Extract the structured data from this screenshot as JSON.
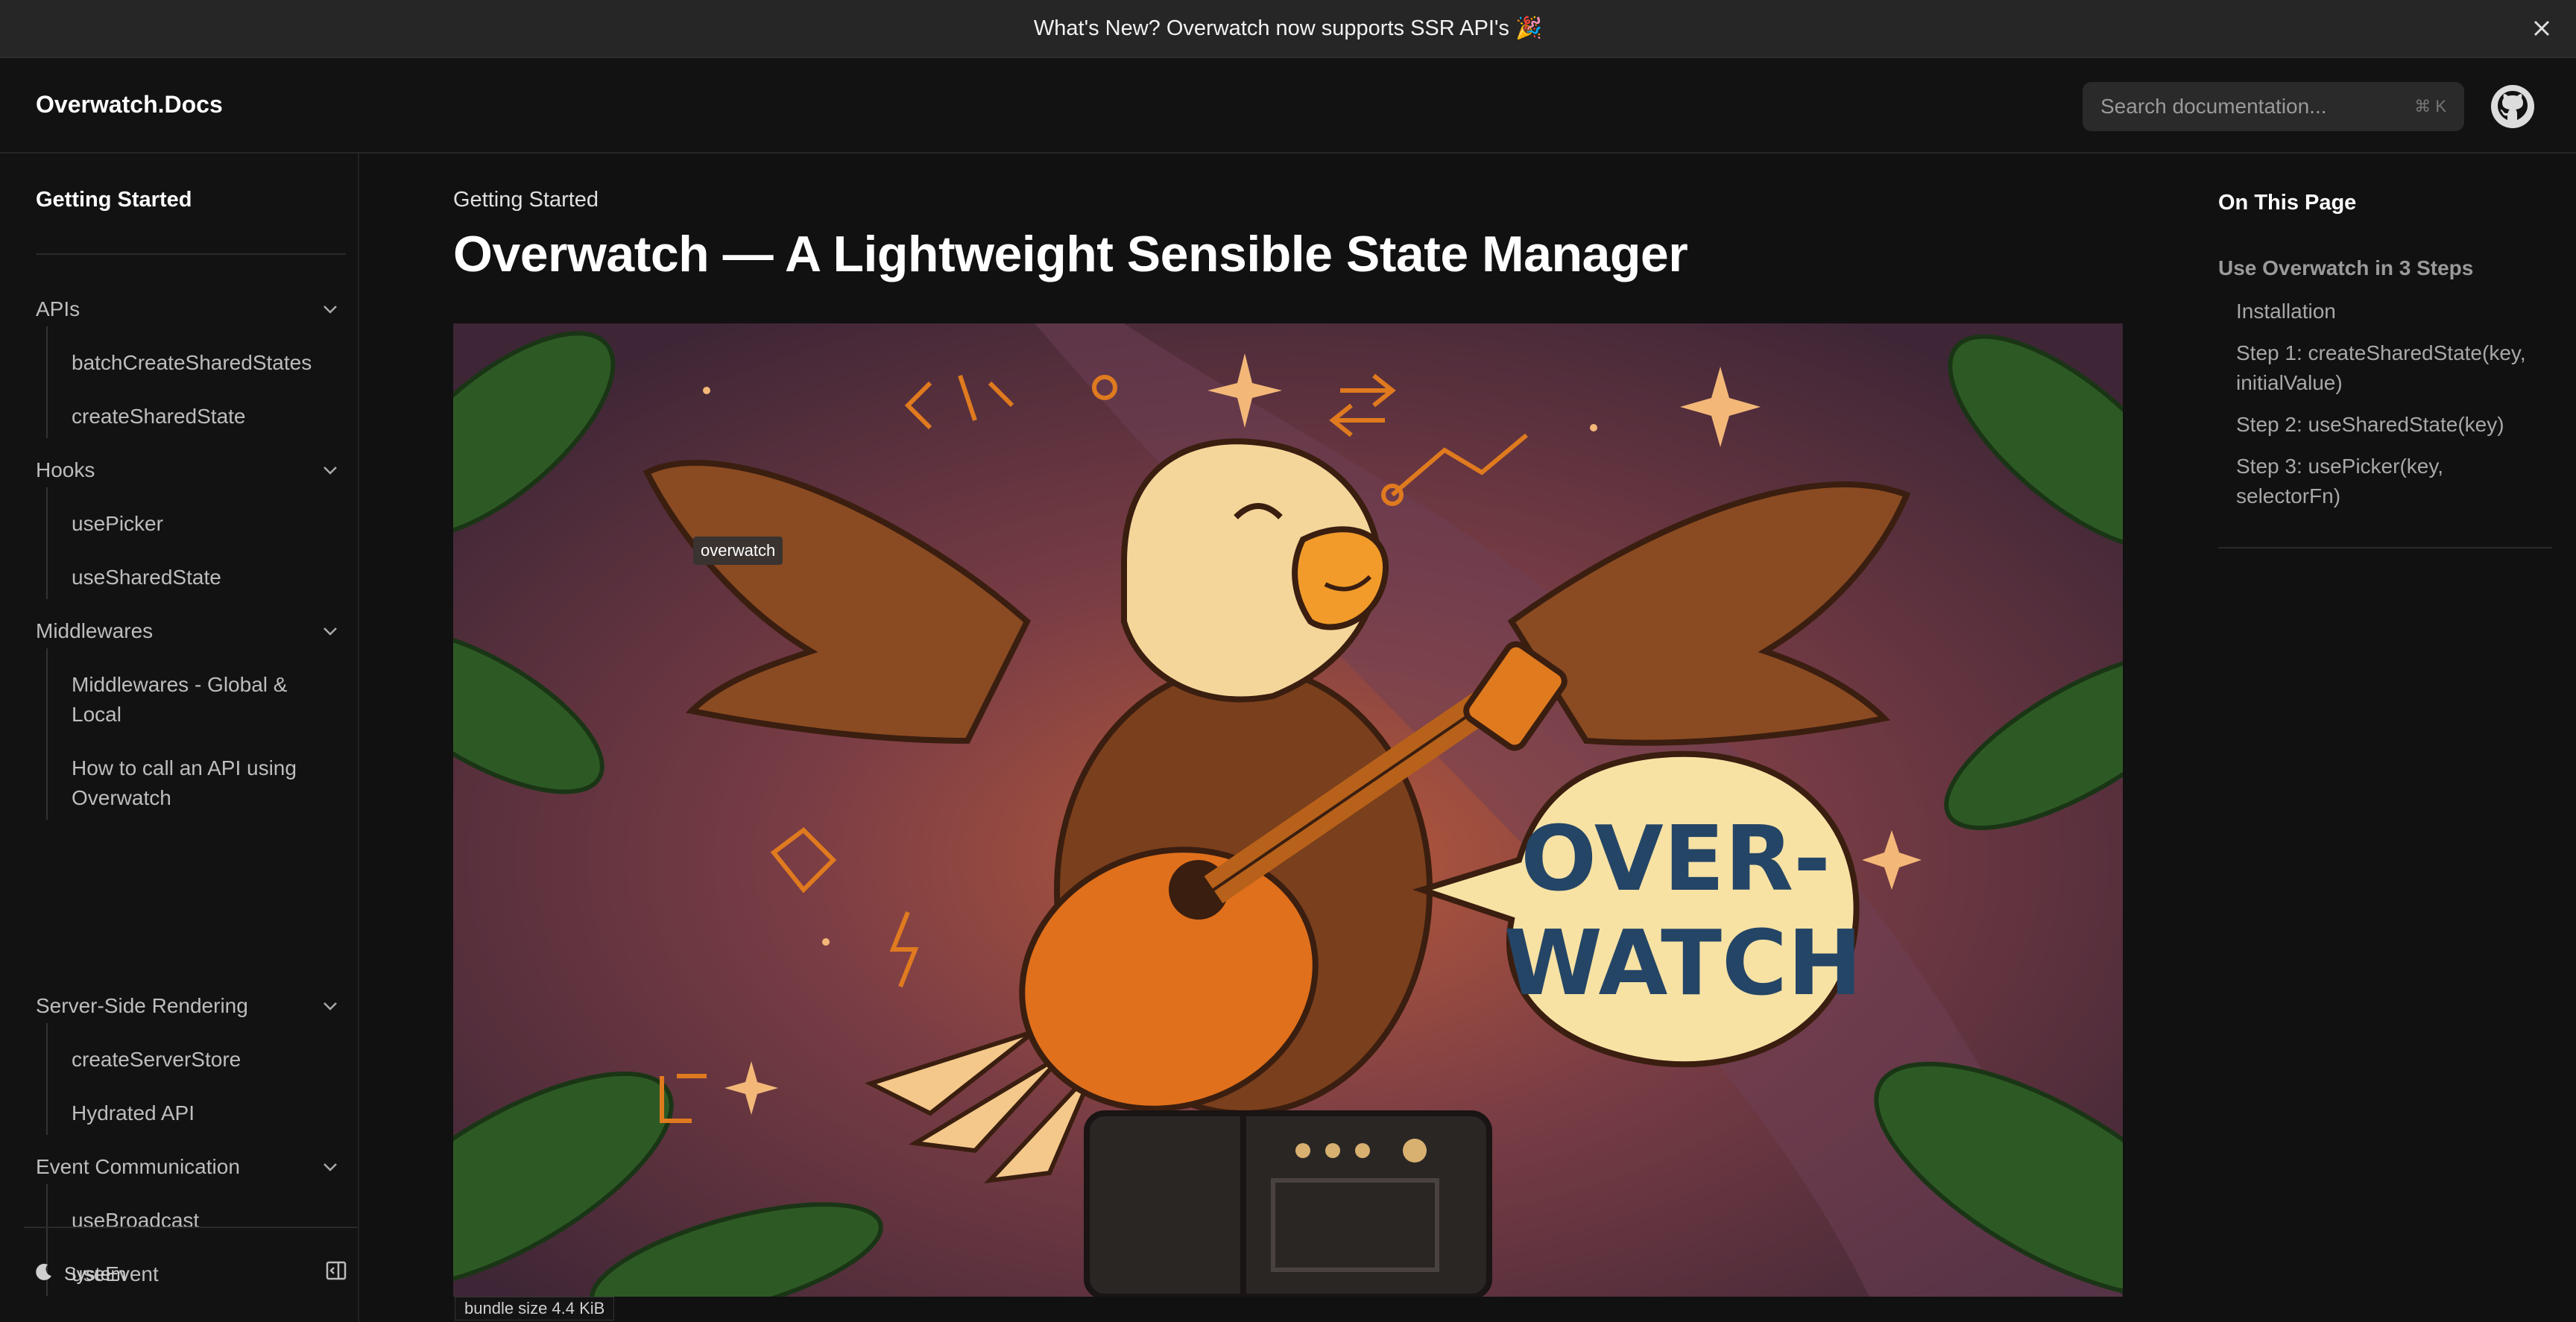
{
  "banner": {
    "text": "What's New? Overwatch now supports SSR API's 🎉",
    "close_icon": "close-icon"
  },
  "header": {
    "logo": "Overwatch.Docs",
    "search_placeholder": "Search documentation...",
    "search_shortcut": "⌘ K",
    "github_icon": "github-icon"
  },
  "sidebar": {
    "title": "Getting Started",
    "groups": [
      {
        "label": "APIs",
        "items": [
          "batchCreateSharedStates",
          "createSharedState"
        ]
      },
      {
        "label": "Hooks",
        "items": [
          "usePicker",
          "useSharedState"
        ]
      },
      {
        "label": "Middlewares",
        "items": [
          "Middlewares - Global & Local",
          "How to call an API using Overwatch"
        ]
      },
      {
        "label": "Server-Side Rendering",
        "items": [
          "createServerStore",
          "Hydrated API"
        ]
      },
      {
        "label": "Event Communication",
        "items": [
          "useBroadcast",
          "useEvent"
        ]
      }
    ],
    "theme_label": "System"
  },
  "main": {
    "breadcrumb": "Getting Started",
    "title": "Overwatch — A Lightweight Sensible State Manager",
    "hero_tooltip": "overwatch",
    "hero_bubble_line1": "OVER-",
    "hero_bubble_line2": "WATCH",
    "bundle_badge": "bundle size  4.4 KiB"
  },
  "toc": {
    "title": "On This Page",
    "main_link": "Use Overwatch in 3 Steps",
    "links": [
      "Installation",
      "Step 1: createSharedState(key, initialValue)",
      "Step 2: useSharedState(key)",
      "Step 3: usePicker(key, selectorFn)"
    ]
  },
  "colors": {
    "background": "#111111",
    "banner": "#262626",
    "accent_orange": "#e07a1f",
    "bubble": "#f7e2a4",
    "bubble_text": "#244566"
  }
}
